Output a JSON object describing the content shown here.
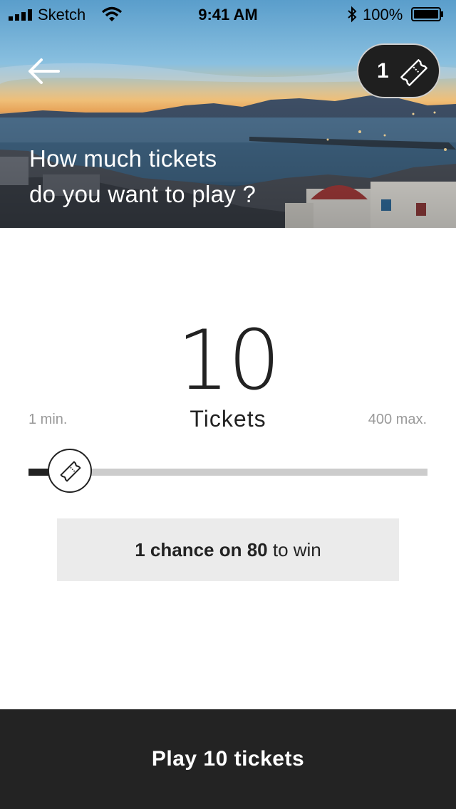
{
  "status_bar": {
    "carrier": "Sketch",
    "time": "9:41 AM",
    "battery": "100%"
  },
  "header": {
    "ticket_count": "1",
    "question_line1": "How much tickets",
    "question_line2": "do you want to play ?"
  },
  "selector": {
    "value": "10",
    "unit": "Tickets",
    "min_label": "1 min.",
    "max_label": "400 max.",
    "min": 1,
    "max": 400,
    "current": 10
  },
  "chance": {
    "prefix": "1 chance on 80",
    "suffix": " to win"
  },
  "footer": {
    "play_label": "Play 10 tickets"
  },
  "colors": {
    "dark": "#232323",
    "track": "#cccccc",
    "box": "#ebebeb",
    "muted": "#9a9a9a"
  },
  "icons": [
    "back-arrow-icon",
    "ticket-icon",
    "wifi-icon",
    "bluetooth-icon",
    "battery-icon",
    "signal-icon"
  ]
}
